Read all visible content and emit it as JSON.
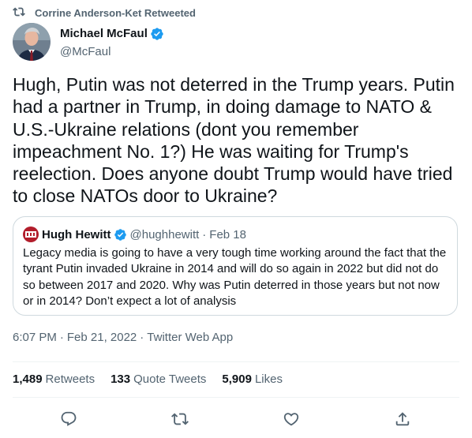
{
  "retweet_context": {
    "text": "Corrine Anderson-Ket Retweeted",
    "icon": "retweet-icon"
  },
  "author": {
    "name": "Michael McFaul",
    "handle": "@McFaul",
    "verified": true
  },
  "text": "Hugh, Putin was not deterred in the Trump years. Putin had a partner in Trump, in doing damage to NATO & U.S.-Ukraine relations (dont you remember impeachment No. 1?) He was waiting for Trump's reelection. Does anyone doubt Trump would have tried to close NATOs door to Ukraine?",
  "quote": {
    "name": "Hugh Hewitt",
    "handle": "@hughhewitt",
    "dot": "·",
    "date": "Feb 18",
    "text": "Legacy media is going to have a very tough time working around the fact that the tyrant Putin invaded Ukraine in 2014 and will do so again in 2022 but did not do so between 2017 and 2020. Why was Putin deterred in those years but not now or in 2014? Don’t expect a lot of analysis"
  },
  "meta": {
    "time": "6:07 PM",
    "sep": "·",
    "date": "Feb 21, 2022",
    "source": "Twitter Web App"
  },
  "stats": {
    "retweets_count": "1,489",
    "retweets_label": "Retweets",
    "quotes_count": "133",
    "quotes_label": "Quote Tweets",
    "likes_count": "5,909",
    "likes_label": "Likes"
  },
  "actions": [
    "reply-icon",
    "retweet-icon",
    "like-icon",
    "share-icon"
  ],
  "colors": {
    "verified": "#1d9bf0",
    "muted": "#536471",
    "text": "#0f1419",
    "border": "#cfd9de"
  }
}
